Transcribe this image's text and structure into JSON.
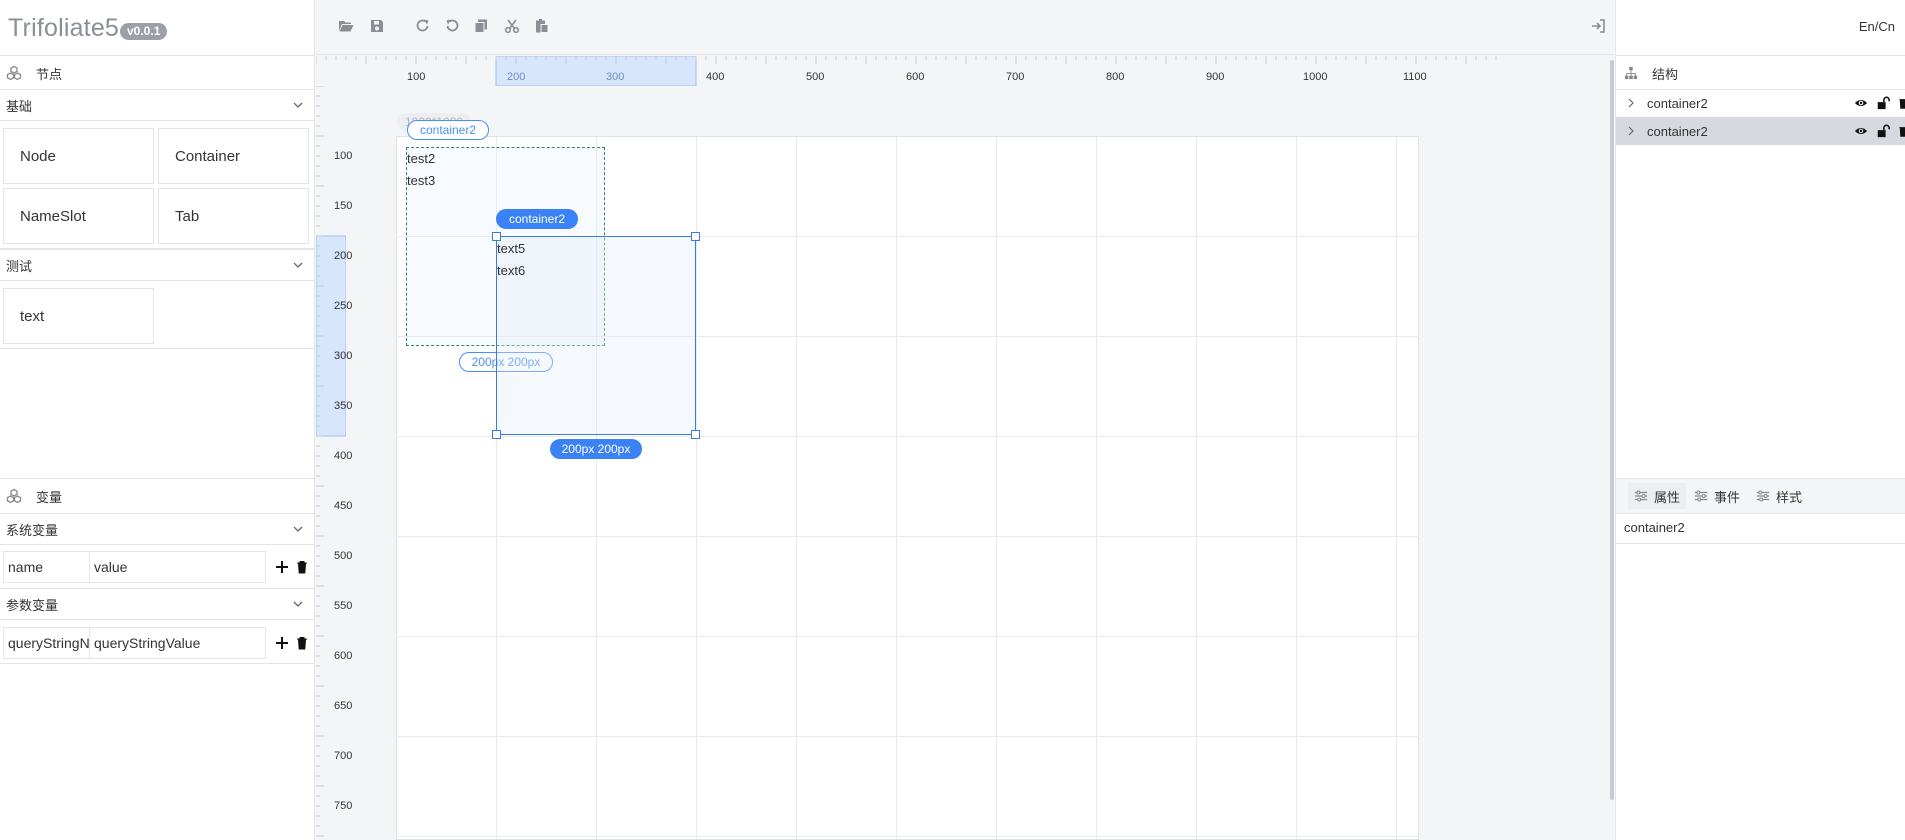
{
  "app": {
    "name": "Trifoliate5",
    "version": "v0.0.1",
    "lang_toggle": "En/Cn"
  },
  "nodes_panel": {
    "title": "节点",
    "groups": [
      {
        "label": "基础",
        "items": [
          "Node",
          "Container",
          "NameSlot",
          "Tab"
        ]
      },
      {
        "label": "测试",
        "items": [
          "text"
        ]
      }
    ]
  },
  "variables_panel": {
    "title": "变量",
    "system": {
      "label": "系统变量",
      "name": "name",
      "value": "value"
    },
    "params": {
      "label": "参数变量",
      "name": "queryStringN",
      "value": "queryStringValue"
    }
  },
  "toolbar": {
    "icons": [
      "folder-open-icon",
      "save-icon",
      "redo-icon",
      "undo-icon",
      "copy-icon",
      "cut-icon",
      "paste-icon"
    ],
    "right_icon": "sign-in-icon"
  },
  "rulers": {
    "top": [
      "100",
      "200",
      "300",
      "400",
      "500",
      "600",
      "700",
      "800",
      "900",
      "1000",
      "1100"
    ],
    "left": [
      "100",
      "150",
      "200",
      "250",
      "300",
      "350",
      "400",
      "450",
      "500",
      "550",
      "600",
      "650",
      "700",
      "750"
    ]
  },
  "canvas": {
    "frame_size_label": "1920*1080",
    "outer_container": {
      "tag": "container2",
      "texts": [
        "test2",
        "test3"
      ],
      "size": "200px 200px"
    },
    "selected_container": {
      "tag": "container2",
      "texts": [
        "text5",
        "text6"
      ],
      "size": "200px 200px"
    }
  },
  "structure_panel": {
    "title": "结构",
    "rows": [
      {
        "label": "container2",
        "selected": false
      },
      {
        "label": "container2",
        "selected": true
      }
    ]
  },
  "props_panel": {
    "tabs": [
      "属性",
      "事件",
      "样式"
    ],
    "value": "container2"
  },
  "colors": {
    "accent": "#3b82f6",
    "selected_row": "#d6dae0",
    "ruler_highlight": "#d8e6fb",
    "dashed_border": "#2e8b57"
  }
}
